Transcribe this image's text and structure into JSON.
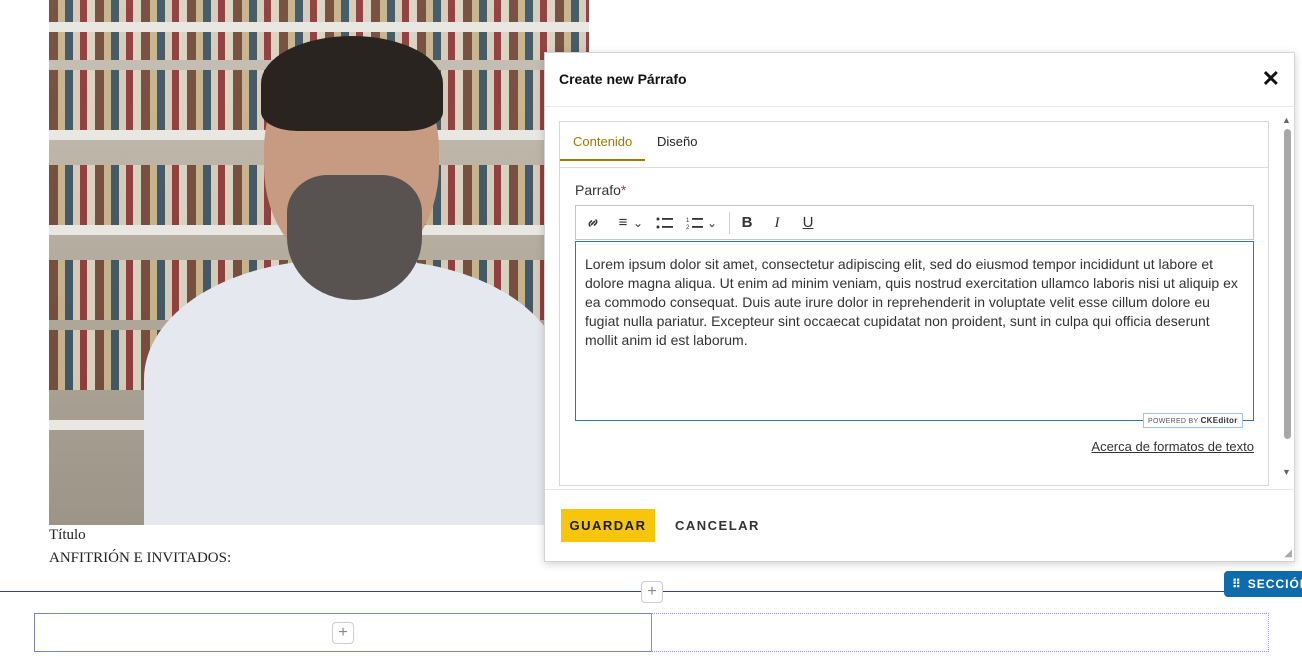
{
  "page": {
    "caption_title": "Título",
    "caption_subtitle": "ANFITRIÓN E INVITADOS:",
    "section_tag": "SECCIÓN",
    "add_symbol": "+"
  },
  "dialog": {
    "title": "Create new Párrafo",
    "close_symbol": "✕",
    "tabs": [
      {
        "label": "Contenido",
        "active": true
      },
      {
        "label": "Diseño",
        "active": false
      }
    ],
    "field_label": "Parrafo",
    "required_marker": "*",
    "toolbar": {
      "link": "🔗",
      "align": "≡",
      "bullets": "☰",
      "numbered": "⒈",
      "bold": "B",
      "italic": "I",
      "underline": "U",
      "chevron": "⌄"
    },
    "editor_text": "Lorem ipsum dolor sit amet, consectetur adipiscing elit, sed do eiusmod tempor incididunt ut labore et dolore magna aliqua. Ut enim ad minim veniam, quis nostrud exercitation ullamco laboris nisi ut aliquip ex ea commodo consequat. Duis aute irure dolor in reprehenderit in voluptate velit esse cillum dolore eu fugiat nulla pariatur. Excepteur sint occaecat cupidatat non proident, sunt in culpa qui officia deserunt mollit anim id est laborum.",
    "ck_badge_prefix": "POWERED BY",
    "ck_badge_brand": "CKEditor",
    "format_link": "Acerca de formatos de texto",
    "save_label": "GUARDAR",
    "cancel_label": "CANCELAR"
  },
  "colors": {
    "accent_tab": "#a07800",
    "save_button": "#f7c60a",
    "section_tag": "#0f6cac",
    "editor_border": "#2d75b8"
  }
}
